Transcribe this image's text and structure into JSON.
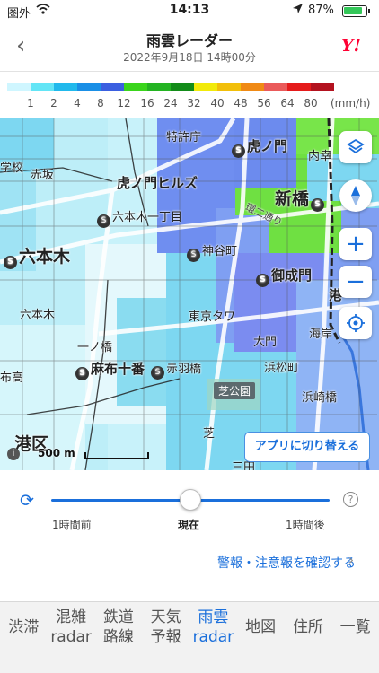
{
  "status_bar": {
    "carrier": "圏外",
    "time": "14:13",
    "battery": "87%"
  },
  "header": {
    "title": "雨雲レーダー",
    "subtitle": "2022年9月18日 14時00分",
    "back_icon": "chevron-left-icon",
    "logo": "Y!"
  },
  "legend": {
    "colors": [
      "#cff6ff",
      "#63e5f6",
      "#21b9ec",
      "#1a8fe6",
      "#3b5fe0",
      "#3ad51c",
      "#24b422",
      "#138c19",
      "#f2ea0a",
      "#f2bf0a",
      "#f08a15",
      "#ea5a5a",
      "#e51b1b",
      "#b3121f"
    ],
    "labels": [
      "1",
      "2",
      "4",
      "8",
      "12",
      "16",
      "24",
      "32",
      "40",
      "48",
      "56",
      "64",
      "80"
    ],
    "unit": "(mm/h)"
  },
  "map": {
    "labels": {
      "tokkyocho": "特許庁",
      "toranomon": "虎ノ門",
      "uchisaiwai": "内幸",
      "gakko": "学校",
      "akasaka": "赤坂",
      "toranomon_hills": "虎ノ門ヒルズ",
      "shinbashi": "新橋",
      "roppongi_1": "六本木一丁目",
      "loop2": "環二通り",
      "roppongi": "六本木",
      "kamiyacho": "神谷町",
      "onarimon": "御成門",
      "roppongi_small": "六本木",
      "tokyo_tower": "東京タワ",
      "minato": "港",
      "ichinohashi": "一ノ橋",
      "daimon": "大門",
      "kaigan": "海岸",
      "azabu_juban": "麻布十番",
      "akabanebashi": "赤羽橋",
      "hamamatsucho": "浜松町",
      "nishiazabu": "布高",
      "shibakoen": "芝公園",
      "hamazakibashi": "浜崎橋",
      "shiba": "芝",
      "minato_ku": "港区",
      "mita": "三田"
    },
    "scale_label": "500 m",
    "switch_app_label": "アプリに切り替える",
    "buttons": {
      "layers": "layers-icon",
      "compass": "compass-icon",
      "zoom_in": "+",
      "zoom_out": "−",
      "locate": "locate-icon"
    }
  },
  "timeline": {
    "labels": [
      "1時間前",
      "現在",
      "1時間後"
    ],
    "position": 0.5,
    "warning_link": "警報・注意報を確認する"
  },
  "tabs": [
    {
      "l1": "渋滞",
      "l2": ""
    },
    {
      "l1": "混雑",
      "l2": "radar"
    },
    {
      "l1": "鉄道",
      "l2": "路線"
    },
    {
      "l1": "天気",
      "l2": "予報"
    },
    {
      "l1": "雨雲",
      "l2": "radar",
      "active": true
    },
    {
      "l1": "地図",
      "l2": ""
    },
    {
      "l1": "住所",
      "l2": ""
    },
    {
      "l1": "一覧",
      "l2": ""
    }
  ]
}
